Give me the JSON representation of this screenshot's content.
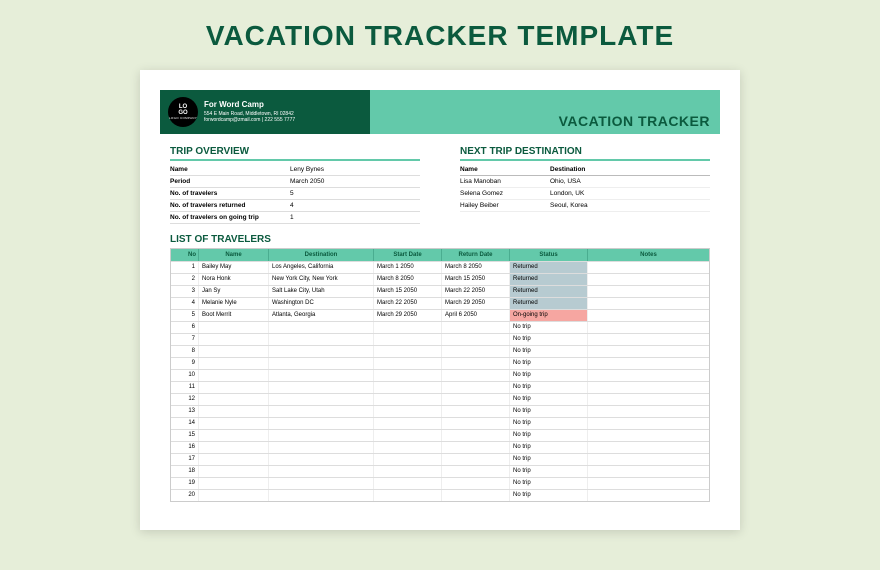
{
  "page_title": "VACATION TRACKER TEMPLATE",
  "header": {
    "logo_line1": "LO",
    "logo_line2": "GO",
    "logo_sub": "LOGO COMPANY",
    "brand": "For Word Camp",
    "address": "554 E Main Road, Middletown, RI 02842",
    "contact": "forwordcamp@zmail.com | 222 555 7777",
    "tracker_title": "VACATION TRACKER"
  },
  "overview": {
    "title": "TRIP OVERVIEW",
    "rows": [
      {
        "k": "Name",
        "v": "Leny Bynes"
      },
      {
        "k": "Period",
        "v": "March 2050"
      },
      {
        "k": "No. of travelers",
        "v": "5"
      },
      {
        "k": "No. of travelers returned",
        "v": "4"
      },
      {
        "k": "No. of travelers on going trip",
        "v": "1"
      }
    ]
  },
  "next_trip": {
    "title": "NEXT TRIP DESTINATION",
    "head_name": "Name",
    "head_dest": "Destination",
    "rows": [
      {
        "name": "Lisa Manoban",
        "dest": "Ohio, USA"
      },
      {
        "name": "Selena Gomez",
        "dest": "London, UK"
      },
      {
        "name": "Hailey Beiber",
        "dest": "Seoul, Korea"
      }
    ]
  },
  "list": {
    "title": "LIST OF TRAVELERS",
    "head": {
      "no": "No",
      "name": "Name",
      "dest": "Destination",
      "start": "Start Date",
      "return": "Return Date",
      "status": "Status",
      "notes": "Notes"
    },
    "rows": [
      {
        "no": "1",
        "name": "Bailey May",
        "dest": "Los Angeles, California",
        "start": "March 1 2050",
        "return": "March 8 2050",
        "status": "Returned",
        "cls": "status-returned"
      },
      {
        "no": "2",
        "name": "Nora Honk",
        "dest": "New York City, New York",
        "start": "March 8 2050",
        "return": "March 15 2050",
        "status": "Returned",
        "cls": "status-returned"
      },
      {
        "no": "3",
        "name": "Jan Sy",
        "dest": "Salt Lake City, Utah",
        "start": "March 15 2050",
        "return": "March 22 2050",
        "status": "Returned",
        "cls": "status-returned"
      },
      {
        "no": "4",
        "name": "Melanie Nyle",
        "dest": "Washington DC",
        "start": "March 22 2050",
        "return": "March 29 2050",
        "status": "Returned",
        "cls": "status-returned"
      },
      {
        "no": "5",
        "name": "Boot Merrit",
        "dest": "Atlanta, Georgia",
        "start": "March 29 2050",
        "return": "April 6 2050",
        "status": "On-going trip",
        "cls": "status-ongoing"
      },
      {
        "no": "6",
        "name": "",
        "dest": "",
        "start": "",
        "return": "",
        "status": "No trip",
        "cls": ""
      },
      {
        "no": "7",
        "name": "",
        "dest": "",
        "start": "",
        "return": "",
        "status": "No trip",
        "cls": ""
      },
      {
        "no": "8",
        "name": "",
        "dest": "",
        "start": "",
        "return": "",
        "status": "No trip",
        "cls": ""
      },
      {
        "no": "9",
        "name": "",
        "dest": "",
        "start": "",
        "return": "",
        "status": "No trip",
        "cls": ""
      },
      {
        "no": "10",
        "name": "",
        "dest": "",
        "start": "",
        "return": "",
        "status": "No trip",
        "cls": ""
      },
      {
        "no": "11",
        "name": "",
        "dest": "",
        "start": "",
        "return": "",
        "status": "No trip",
        "cls": ""
      },
      {
        "no": "12",
        "name": "",
        "dest": "",
        "start": "",
        "return": "",
        "status": "No trip",
        "cls": ""
      },
      {
        "no": "13",
        "name": "",
        "dest": "",
        "start": "",
        "return": "",
        "status": "No trip",
        "cls": ""
      },
      {
        "no": "14",
        "name": "",
        "dest": "",
        "start": "",
        "return": "",
        "status": "No trip",
        "cls": ""
      },
      {
        "no": "15",
        "name": "",
        "dest": "",
        "start": "",
        "return": "",
        "status": "No trip",
        "cls": ""
      },
      {
        "no": "16",
        "name": "",
        "dest": "",
        "start": "",
        "return": "",
        "status": "No trip",
        "cls": ""
      },
      {
        "no": "17",
        "name": "",
        "dest": "",
        "start": "",
        "return": "",
        "status": "No trip",
        "cls": ""
      },
      {
        "no": "18",
        "name": "",
        "dest": "",
        "start": "",
        "return": "",
        "status": "No trip",
        "cls": ""
      },
      {
        "no": "19",
        "name": "",
        "dest": "",
        "start": "",
        "return": "",
        "status": "No trip",
        "cls": ""
      },
      {
        "no": "20",
        "name": "",
        "dest": "",
        "start": "",
        "return": "",
        "status": "No trip",
        "cls": ""
      }
    ]
  }
}
